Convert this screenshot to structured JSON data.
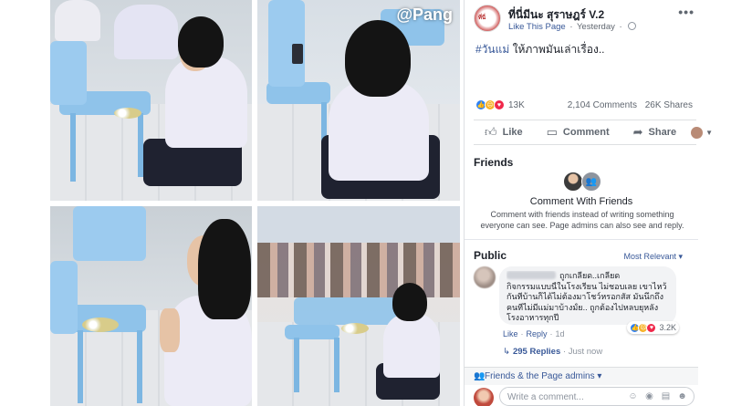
{
  "colors": {
    "link": "#385898",
    "text": "#1d2129",
    "secondary_text": "#606770",
    "like": "#2e81f4",
    "love": "#f0284a",
    "haha": "#f7b125"
  },
  "watermark": "@Pang",
  "post": {
    "page_name": "ที่นี่มีนะ สุราษฎร์ V.2",
    "like_this_page": "Like This Page",
    "meta_separator": "·",
    "time": "Yesterday",
    "hashtag": "#วันแม่",
    "text": " ให้ภาพมันเล่าเรื่อง..",
    "reaction_count": "13K",
    "comments_count": "2,104 Comments",
    "shares_count": "26K Shares",
    "more_icon": "more-horizontal-icon"
  },
  "actions": {
    "like": "Like",
    "comment": "Comment",
    "share": "Share"
  },
  "friends": {
    "title": "Friends",
    "cwf_title": "Comment With Friends",
    "cwf_desc": "Comment with friends instead of writing something everyone can see. Page admins can also see and reply."
  },
  "public": {
    "title": "Public",
    "sort": "Most Relevant ▾"
  },
  "comment": {
    "line1": "ถูกเกลียด..เกลียด",
    "line2": "กิจกรรมแบบนี้ในโรงเรียน ไม่ชอบเลย เขาไหว้",
    "line3": "กันที่บ้านก็ได้ไม่ต้องมาโชว์หรอกสัส มันนึกถึง",
    "line4": "คนที่ไม่มีแม่มาบ้างมั้ย.. ถูกต้องไปหลบยุหลัง",
    "line5": "โรงอาหารทุกปี",
    "reaction_count": "3.2K",
    "like_label": "Like",
    "reply_label": "Reply",
    "time": "1d",
    "replies": "295 Replies",
    "replies_time": "· Just now"
  },
  "audience": {
    "label": "Friends & the Page admins ▾"
  },
  "composer": {
    "placeholder": "Write a comment..."
  }
}
